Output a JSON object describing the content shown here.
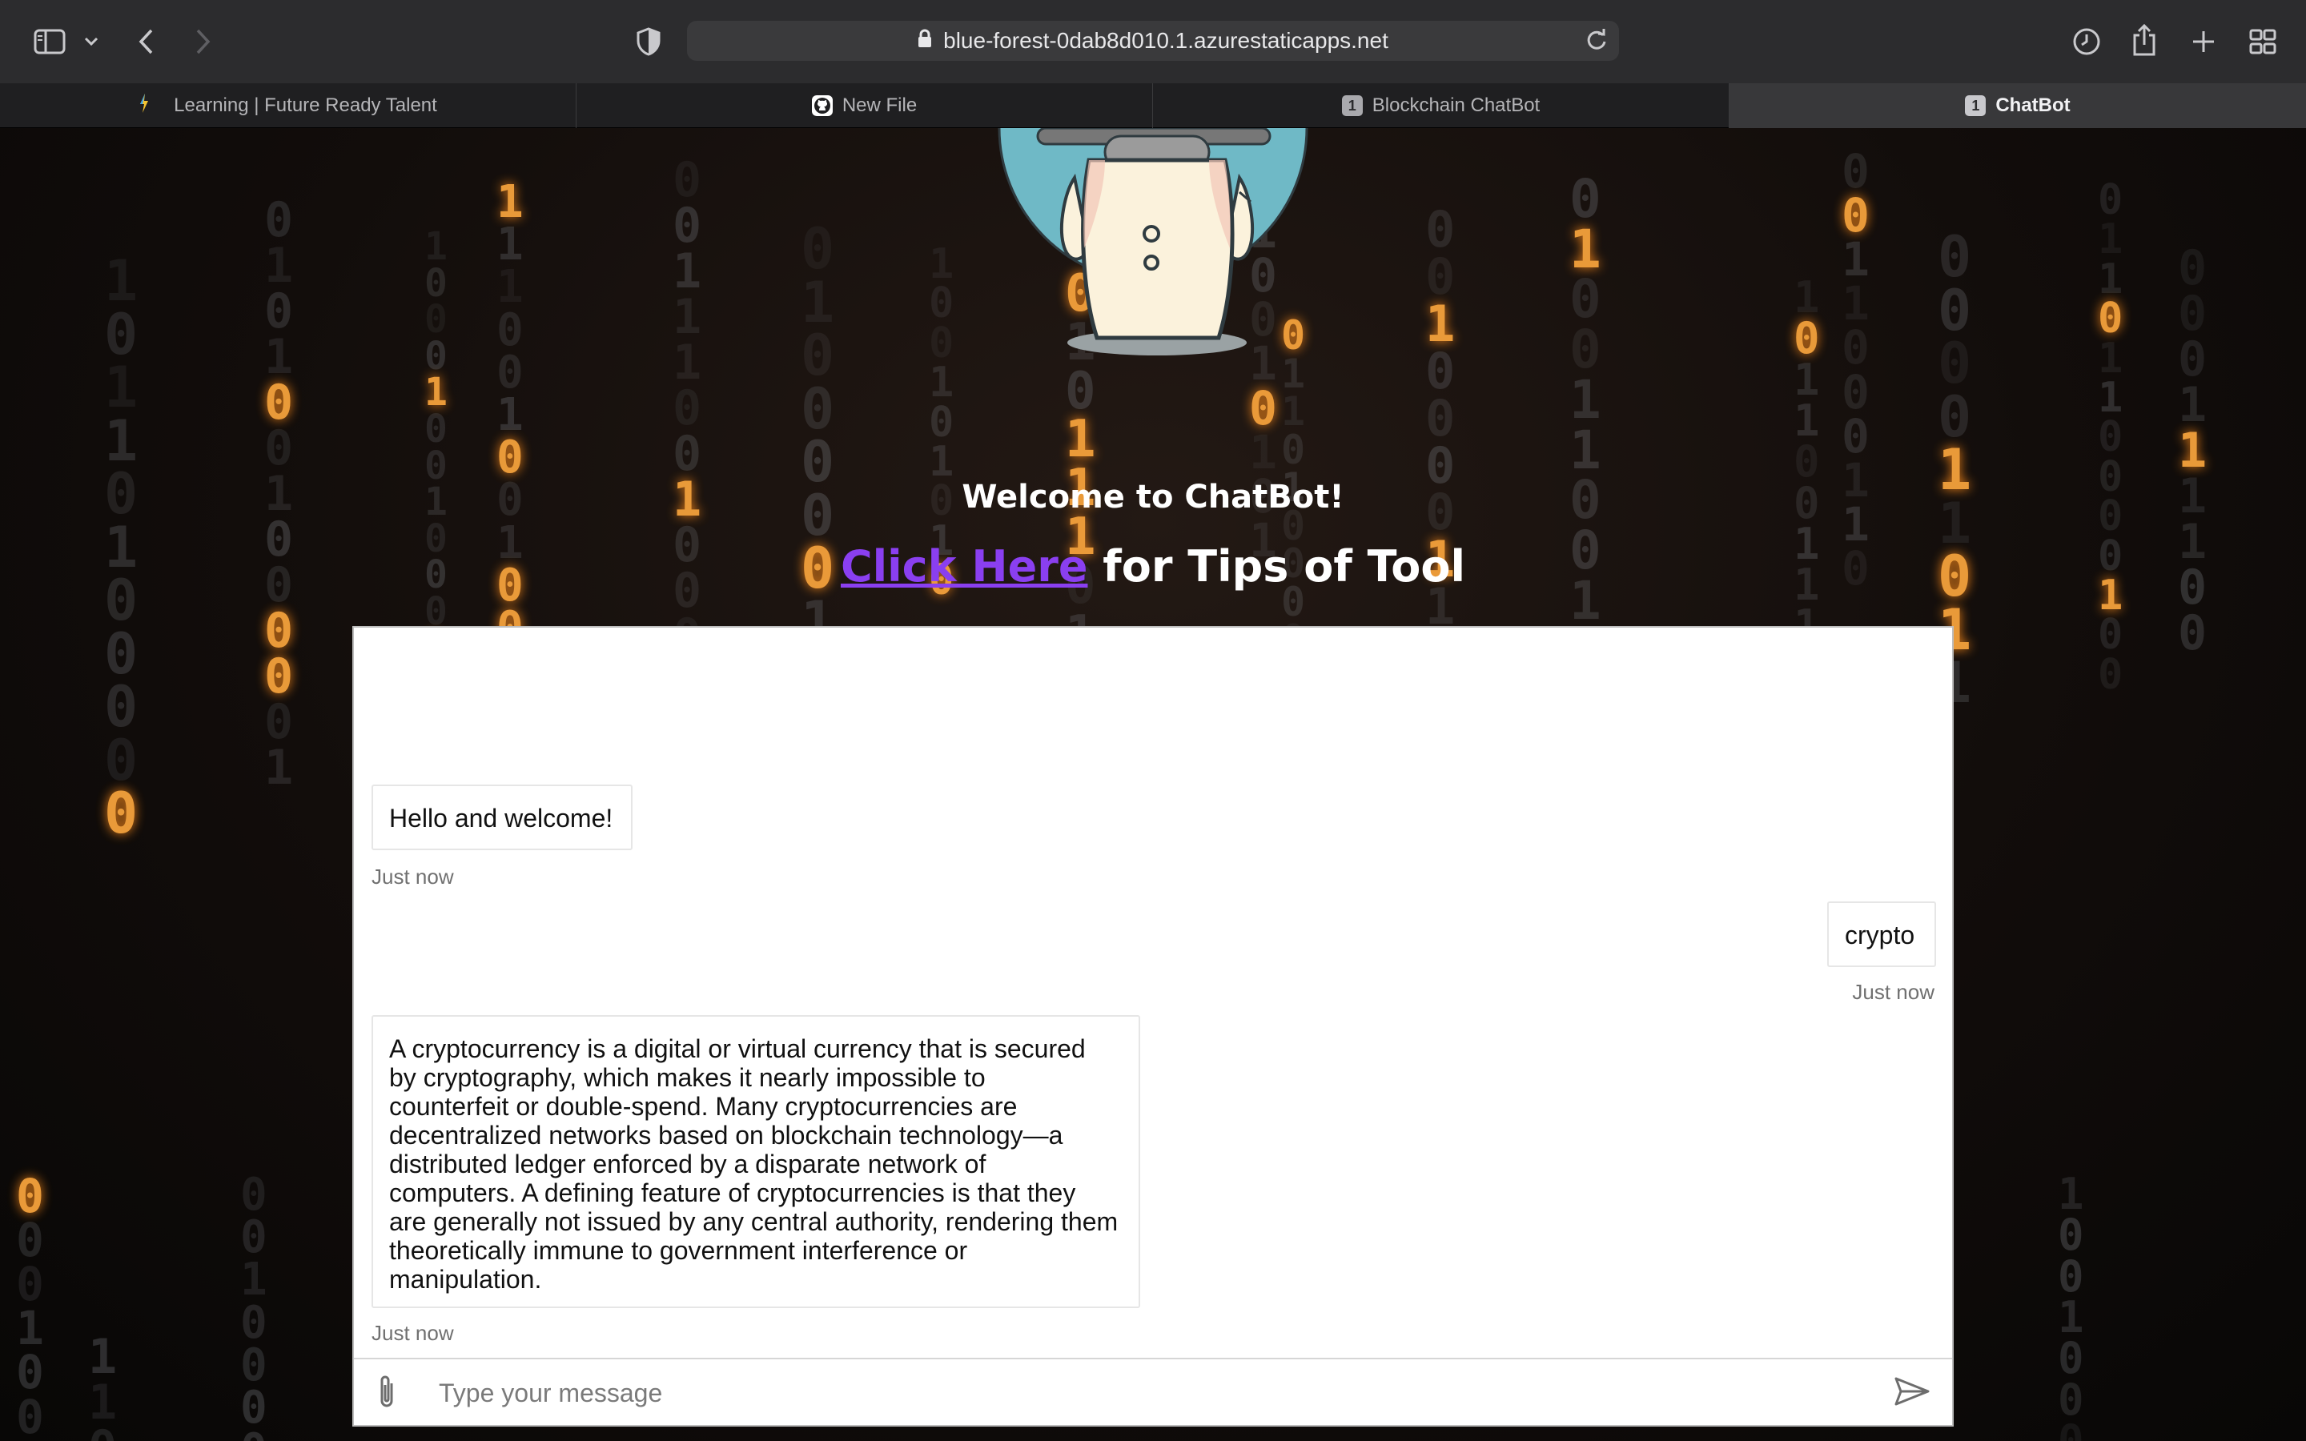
{
  "browser": {
    "url": "blue-forest-0dab8d010.1.azurestaticapps.net",
    "tabs": [
      {
        "title": "Learning | Future Ready Talent",
        "favicon": "bolt-icon",
        "badge": ""
      },
      {
        "title": "New File",
        "favicon": "github-icon",
        "badge": ""
      },
      {
        "title": "Blockchain ChatBot",
        "favicon": "number-badge",
        "badge": "1"
      },
      {
        "title": "ChatBot",
        "favicon": "number-badge",
        "badge": "1",
        "active": true
      }
    ]
  },
  "page": {
    "welcome": "Welcome to ChatBot!",
    "tips_link": "Click Here",
    "tips_rest": " for Tips of Tool",
    "link_color": "#8a3ff0"
  },
  "chat": {
    "messages": [
      {
        "from": "bot",
        "text": "Hello and welcome!",
        "time": "Just now"
      },
      {
        "from": "user",
        "text": "crypto",
        "time": "Just now"
      },
      {
        "from": "bot",
        "lines": [
          "A cryptocurrency is a digital or virtual currency that is secured",
          "by cryptography, which makes it nearly impossible to",
          "counterfeit or double-spend. Many cryptocurrencies are",
          "decentralized networks based on blockchain technology—a",
          "distributed ledger enforced by a disparate network of",
          "computers. A defining feature of cryptocurrencies is that they",
          "are generally not issued by any central authority, rendering them",
          "theoretically immune to government interference or",
          "manipulation."
        ],
        "time": "Just now"
      }
    ],
    "input_placeholder": "Type your message",
    "input_value": ""
  }
}
